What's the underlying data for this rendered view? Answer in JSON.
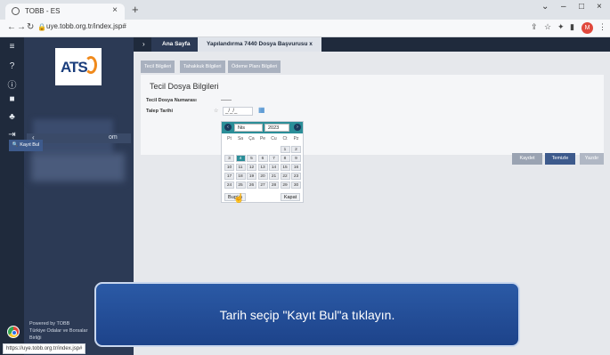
{
  "browser": {
    "tab_title": "TOBB - ES",
    "tab_close": "×",
    "new_tab": "+",
    "url": "uye.tobb.org.tr/index.jsp#",
    "minimize": "–",
    "maximize": "□",
    "close": "×"
  },
  "sidebar": {
    "logo_text": "ATS",
    "user_suffix": "om",
    "powered_line1": "Powered by TOBB",
    "powered_line2": "Türkiye Odalar ve Borsalar",
    "powered_line3": "Birliği"
  },
  "topbar": {
    "home_tab": "Ana Sayfa",
    "form_tab": "Yapılandırma 7440 Dosya Başvurusu",
    "form_tab_close": "x"
  },
  "steps": [
    "Tecil Bilgileri",
    "Tahakkuk Bilgileri",
    "Ödeme Planı Bilgileri"
  ],
  "form": {
    "card_title": "Tecil Dosya Bilgileri",
    "dosya_no_label": "Tecil Dosya Numarası",
    "dosya_no_value": "——",
    "talep_tarihi_label": "Talep Tarihi",
    "date_value": "_/_/_",
    "kayit_bul": "Kayıt Bul"
  },
  "buttons": {
    "kaydet": "Kaydet",
    "temizle": "Temizle",
    "yazdir": "Yazdır"
  },
  "calendar": {
    "month": "Nis",
    "year": "2023",
    "dow": [
      "Pt",
      "Sa",
      "Ça",
      "Pe",
      "Cu",
      "Ct",
      "Pz"
    ],
    "weeks": [
      [
        "",
        "",
        "",
        "",
        "",
        "1",
        "2"
      ],
      [
        "3",
        "4",
        "5",
        "6",
        "7",
        "8",
        "9"
      ],
      [
        "10",
        "11",
        "12",
        "13",
        "14",
        "15",
        "16"
      ],
      [
        "17",
        "18",
        "19",
        "20",
        "21",
        "22",
        "23"
      ],
      [
        "24",
        "25",
        "26",
        "27",
        "28",
        "29",
        "30"
      ]
    ],
    "selected": "4",
    "today_button": "Bugün",
    "close_button": "Kapat"
  },
  "overlay": {
    "text": "Tarih seçip \"Kayıt Bul\"a tıklayın."
  },
  "statusbar": {
    "text": "https://uye.tobb.org.tr/index.jsp#"
  }
}
